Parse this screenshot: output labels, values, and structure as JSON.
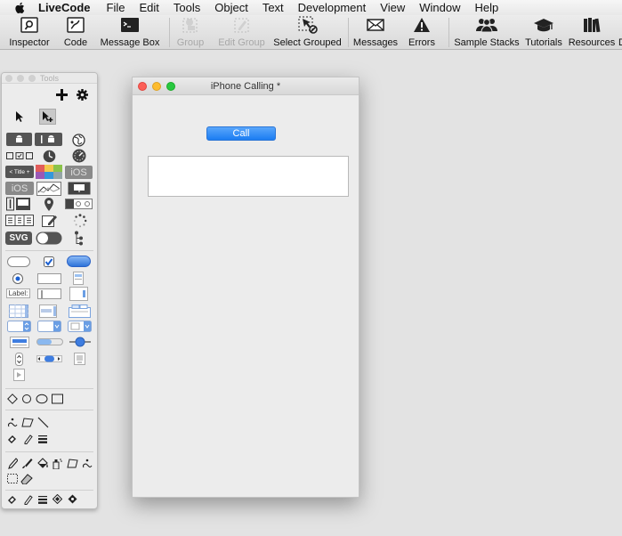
{
  "menubar": {
    "app_name": "LiveCode",
    "items": [
      "File",
      "Edit",
      "Tools",
      "Object",
      "Text",
      "Development",
      "View",
      "Window",
      "Help"
    ]
  },
  "toolbar": {
    "items": [
      {
        "label": "Inspector",
        "icon": "inspector-icon",
        "enabled": true
      },
      {
        "label": "Code",
        "icon": "code-icon",
        "enabled": true
      },
      {
        "label": "Message Box",
        "icon": "message-box-icon",
        "enabled": true
      },
      {
        "label": "Group",
        "icon": "group-icon",
        "enabled": false
      },
      {
        "label": "Edit Group",
        "icon": "edit-group-icon",
        "enabled": false
      },
      {
        "label": "Select Grouped",
        "icon": "select-grouped-icon",
        "enabled": true
      },
      {
        "label": "Messages",
        "icon": "messages-icon",
        "enabled": true
      },
      {
        "label": "Errors",
        "icon": "errors-icon",
        "enabled": true
      },
      {
        "label": "Sample Stacks",
        "icon": "sample-stacks-icon",
        "enabled": true
      },
      {
        "label": "Tutorials",
        "icon": "tutorials-icon",
        "enabled": true
      },
      {
        "label": "Resources",
        "icon": "resources-icon",
        "enabled": true
      },
      {
        "label": "D",
        "icon": "",
        "enabled": true
      }
    ]
  },
  "tools_palette": {
    "title": "Tools",
    "label_widget_text": "Label:",
    "svg_widget_text": "SVG",
    "ios_text": "iOS",
    "title_widget_text": "< Title +"
  },
  "stack_window": {
    "title": "iPhone Calling *",
    "call_button_label": "Call",
    "field_value": ""
  },
  "colors": {
    "accent_blue": "#1b7cf2",
    "close": "#fc5f57",
    "minimize": "#fdbc2e",
    "zoom": "#28c840"
  }
}
